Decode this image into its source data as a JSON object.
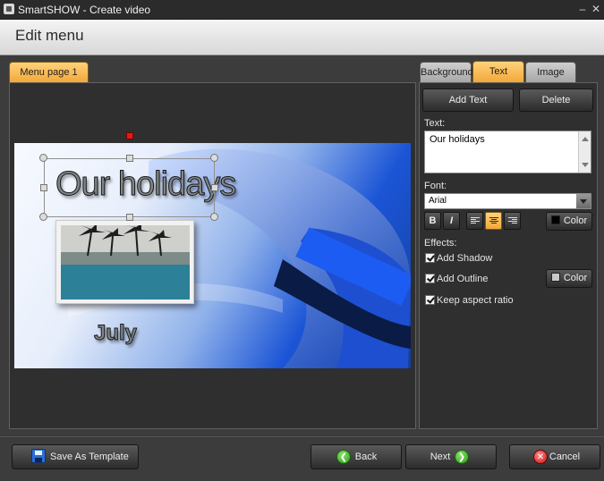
{
  "window": {
    "title": "SmartSHOW - Create video",
    "minimize": "–",
    "close": "✕"
  },
  "header": {
    "title": "Edit menu"
  },
  "canvas": {
    "tab": "Menu page 1",
    "title_text": "Our holidays",
    "caption_text": "July"
  },
  "side": {
    "tabs": [
      "Background",
      "Text",
      "Image"
    ],
    "active_tab": "Text",
    "add_text": "Add Text",
    "delete": "Delete",
    "text_label": "Text:",
    "text_value": "Our holidays",
    "font_label": "Font:",
    "font_value": "Arial",
    "bold": "B",
    "italic": "I",
    "color_label": "Color",
    "text_color": "#000000",
    "effects_label": "Effects:",
    "add_shadow": "Add Shadow",
    "add_outline": "Add Outline",
    "outline_color": "#c8c8c8",
    "keep_aspect": "Keep aspect ratio"
  },
  "footer": {
    "save_template": "Save As Template",
    "back": "Back",
    "next": "Next",
    "cancel": "Cancel"
  }
}
